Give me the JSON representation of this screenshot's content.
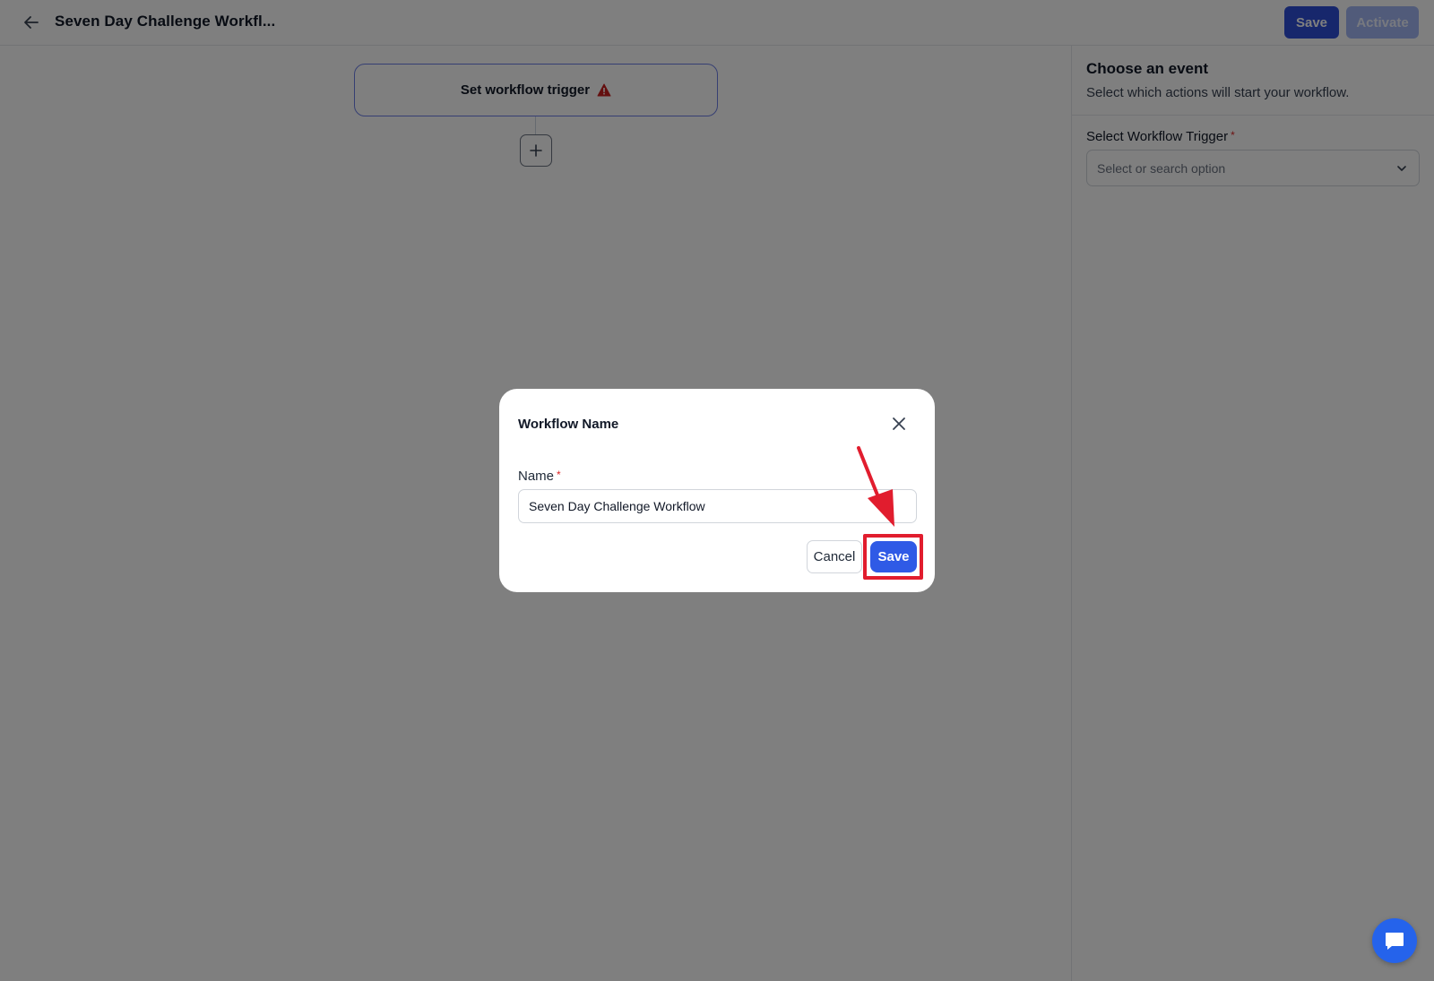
{
  "header": {
    "title": "Seven Day Challenge Workfl...",
    "save_label": "Save",
    "activate_label": "Activate"
  },
  "canvas": {
    "trigger_label": "Set workflow trigger"
  },
  "side_panel": {
    "title": "Choose an event",
    "subtitle": "Select which actions will start your workflow.",
    "trigger_field_label": "Select Workflow Trigger",
    "required_marker": "*",
    "trigger_placeholder": "Select or search option"
  },
  "modal": {
    "title": "Workflow Name",
    "name_label": "Name",
    "required_marker": "*",
    "name_value": "Seven Day Challenge Workflow",
    "cancel_label": "Cancel",
    "save_label": "Save"
  },
  "colors": {
    "primary": "#2f5ae6",
    "header_save": "#2f4ed8",
    "activate_disabled": "#a3b7f4",
    "warning": "#c81e1e",
    "annotation": "#e11d2e",
    "overlay": "rgba(0,0,0,0.50)"
  },
  "icons": {
    "back": "arrow-left-icon",
    "warning": "warning-triangle-icon",
    "add": "plus-icon",
    "dropdown": "chevron-down-icon",
    "close": "close-icon",
    "chat": "chat-bubble-icon"
  }
}
